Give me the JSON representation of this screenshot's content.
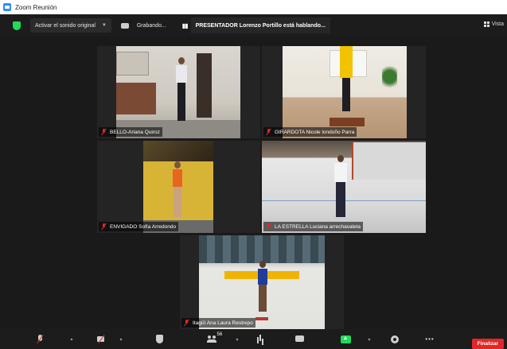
{
  "window": {
    "title": "Zoom Reunión"
  },
  "topbar": {
    "original_sound_label": "Activar el sonido original",
    "recording_label": "Grabando...",
    "speaker_banner": "PRESENTADOR Lorenzo Portillo está hablando...",
    "view_label": "Vista"
  },
  "participants": [
    {
      "name": "BELLO-Ariana Quiroz"
    },
    {
      "name": "GIRARDOTA Nicole londoño Parra"
    },
    {
      "name": "ENVIGADO Sofía Arredondo"
    },
    {
      "name": "LA ESTRELLA Luciana arrechavaleta"
    },
    {
      "name": "Itagüí Ana Laura Restrepo"
    }
  ],
  "toolbar": {
    "participant_count": "56",
    "end_label": "Finalizar"
  },
  "colors": {
    "accent_green": "#23d959",
    "mute_red": "#e02828",
    "end_red": "#e02828",
    "background": "#1a1a1a"
  }
}
